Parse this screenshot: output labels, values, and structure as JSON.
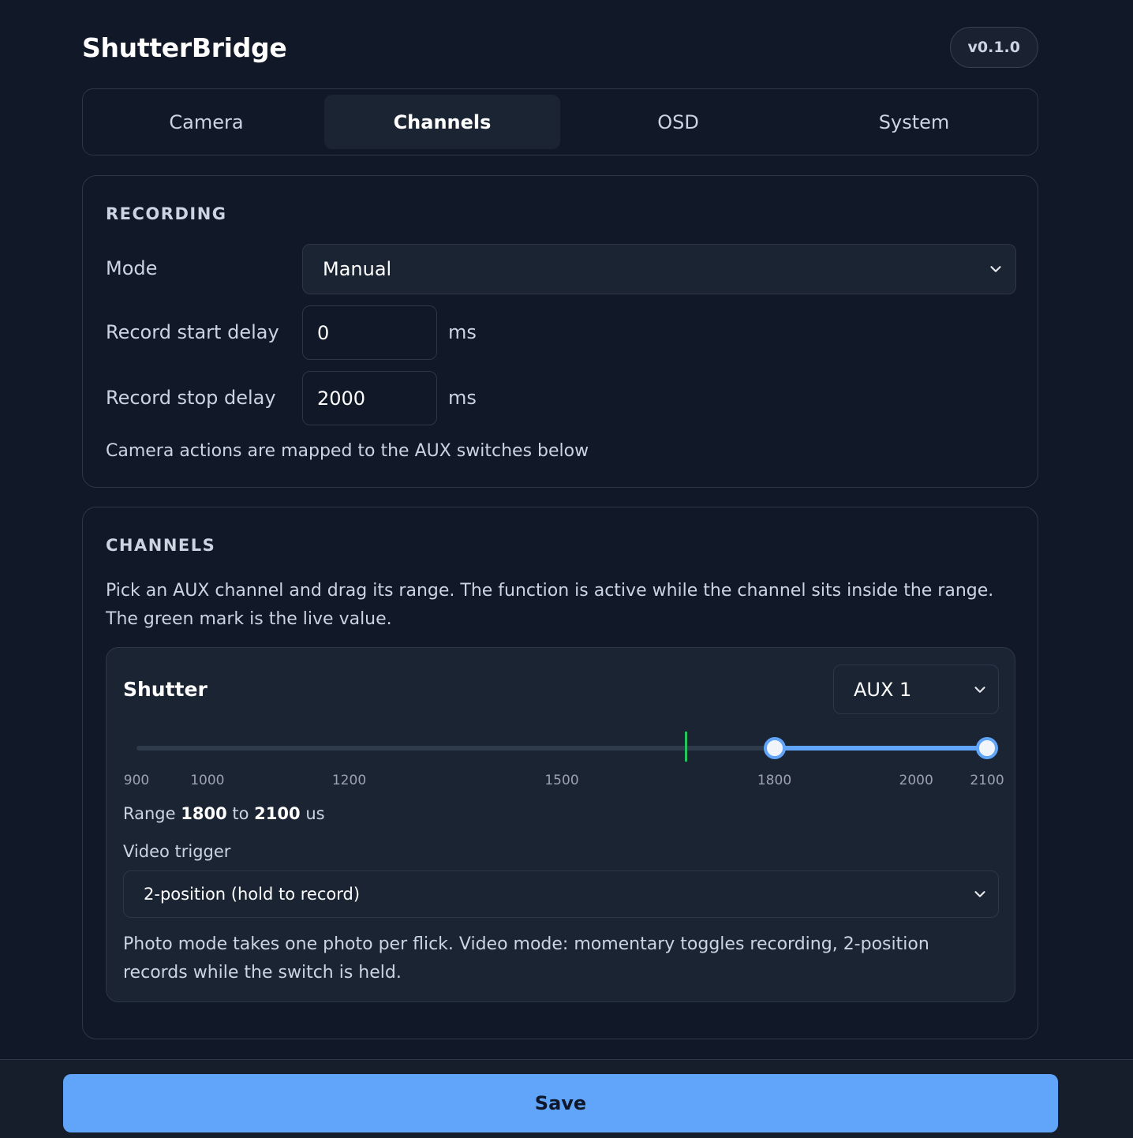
{
  "app": {
    "title": "ShutterBridge",
    "version": "v0.1.0"
  },
  "tabs": [
    {
      "label": "Camera",
      "active": false
    },
    {
      "label": "Channels",
      "active": true
    },
    {
      "label": "OSD",
      "active": false
    },
    {
      "label": "System",
      "active": false
    }
  ],
  "recording": {
    "title": "RECORDING",
    "mode_label": "Mode",
    "mode_value": "Manual",
    "start_delay_label": "Record start delay",
    "start_delay_value": "0",
    "stop_delay_label": "Record stop delay",
    "stop_delay_value": "2000",
    "unit": "ms",
    "hint": "Camera actions are mapped to the AUX switches below"
  },
  "channels": {
    "title": "CHANNELS",
    "intro": "Pick an AUX channel and drag its range. The function is active while the channel sits inside the range. The green mark is the live value.",
    "shutter": {
      "title": "Shutter",
      "aux_value": "AUX 1",
      "slider": {
        "min": 900,
        "max": 2100,
        "range_low": 1800,
        "range_high": 2100,
        "live_value": 1675,
        "ticks": [
          "900",
          "1000",
          "1200",
          "1500",
          "1800",
          "2000",
          "2100"
        ]
      },
      "range_prefix": "Range",
      "range_low_text": "1800",
      "range_mid": "to",
      "range_high_text": "2100",
      "range_unit": "us",
      "video_trigger_label": "Video trigger",
      "video_trigger_value": "2-position (hold to record)",
      "hint": "Photo mode takes one photo per flick. Video mode: momentary toggles recording, 2-position records while the switch is held."
    }
  },
  "footer": {
    "save_label": "Save"
  },
  "colors": {
    "accent": "#60a5fa",
    "live_mark": "#22c55e",
    "background": "#111827"
  }
}
